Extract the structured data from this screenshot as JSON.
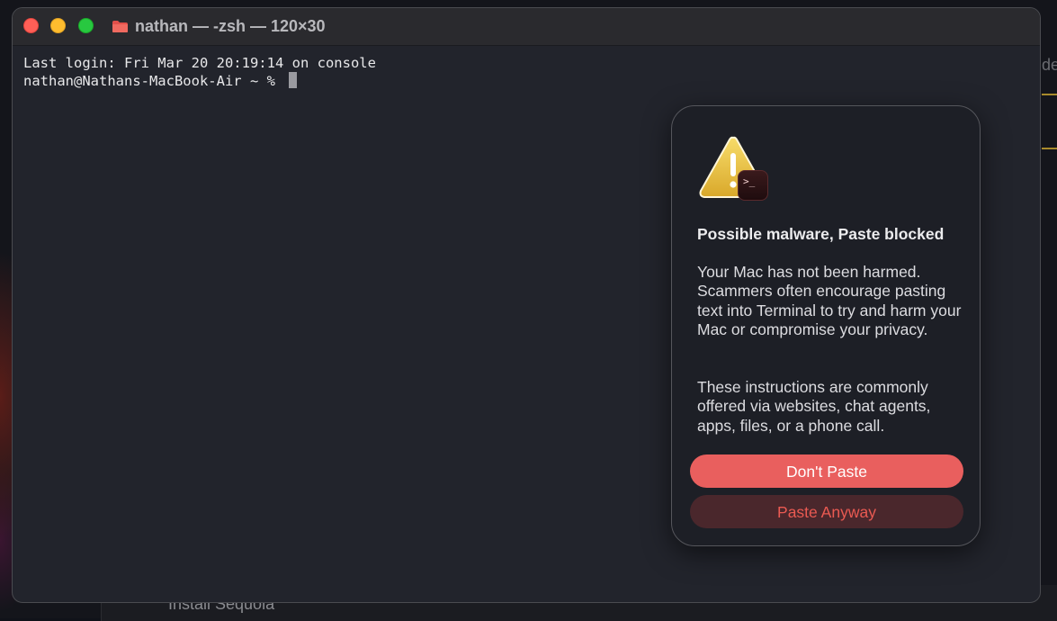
{
  "window": {
    "title": "nathan — -zsh — 120×30"
  },
  "terminal": {
    "lines": [
      "Last login: Fri Mar 20 20:19:14 on console",
      "nathan@Nathans-MacBook-Air ~ % "
    ]
  },
  "alert": {
    "title": "Possible malware, Paste blocked",
    "paragraph1": "Your Mac has not been harmed. Scammers often encourage pasting text into Terminal to try and harm your Mac or compromise your privacy.",
    "paragraph2": "These instructions are commonly offered via websites, chat agents, apps, files, or a phone call.",
    "primary_button": "Don't Paste",
    "secondary_button": "Paste Anyway",
    "icon": "warning-triangle-icon",
    "badge_icon": "terminal-app-icon",
    "badge_glyph": ">_"
  },
  "background": {
    "window_label": "Install Sequoia",
    "edge_text": "de"
  },
  "colors": {
    "close": "#ff5f57",
    "minimize": "#febc2e",
    "zoom": "#28c840",
    "primary_button": "#e95f5e",
    "secondary_button": "#4a272c",
    "secondary_button_text": "#ea5a52",
    "warning_yellow": "#f0c542"
  }
}
